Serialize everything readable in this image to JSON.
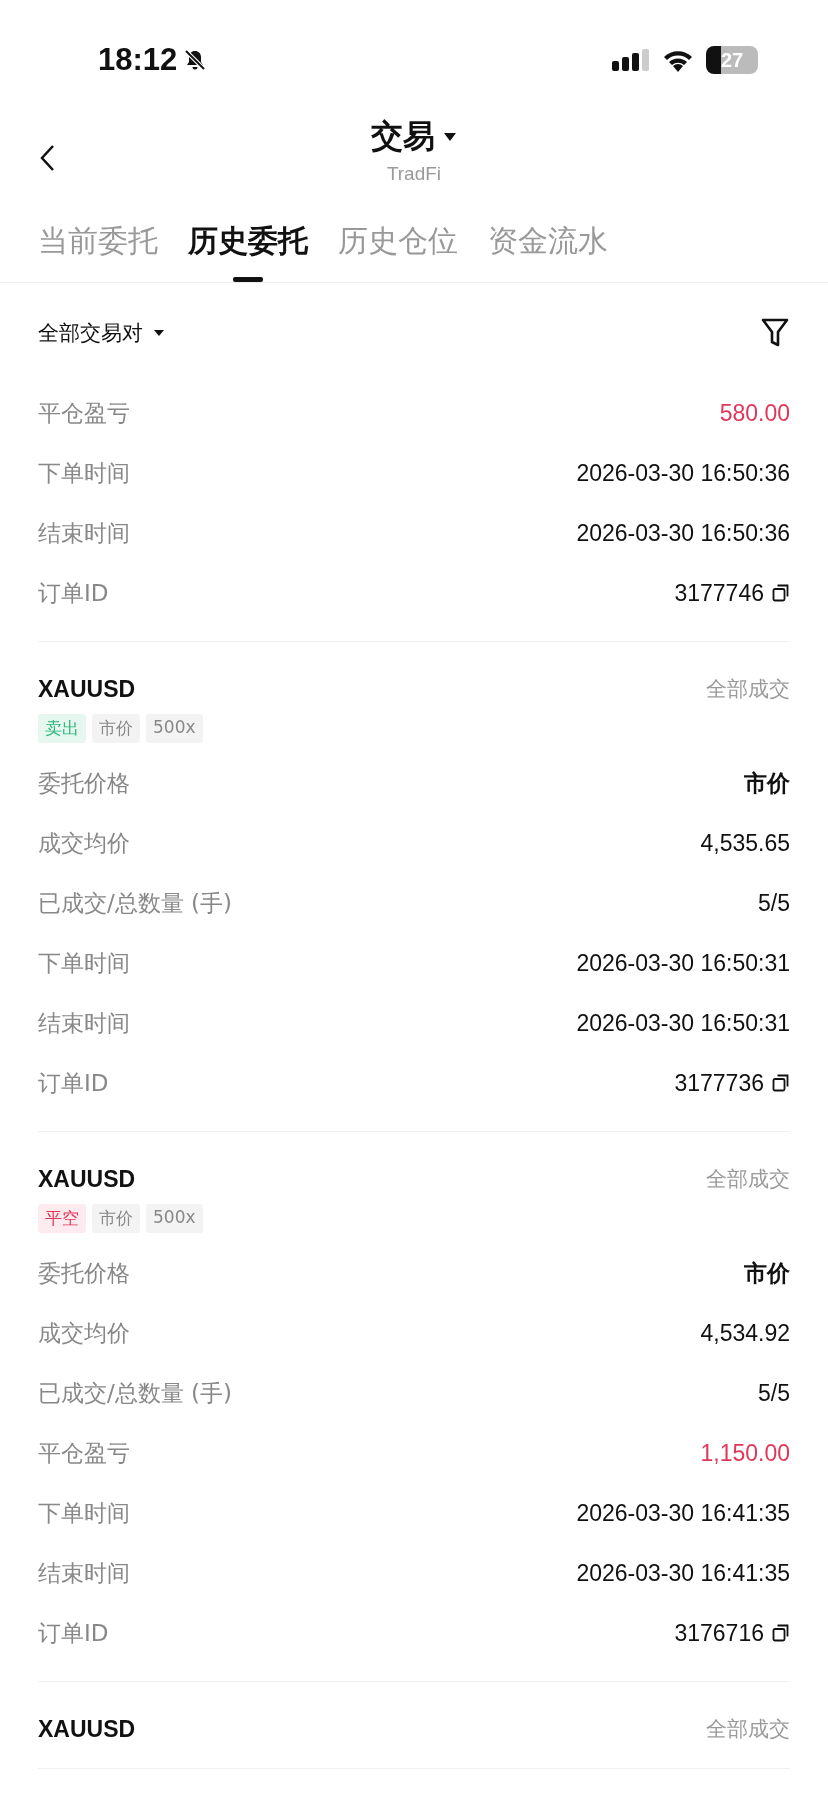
{
  "status_bar": {
    "time": "18:12",
    "battery": "27"
  },
  "header": {
    "title": "交易",
    "subtitle": "TradFi"
  },
  "tabs": [
    {
      "label": "当前委托",
      "selected": false
    },
    {
      "label": "历史委托",
      "selected": true
    },
    {
      "label": "历史仓位",
      "selected": false
    },
    {
      "label": "资金流水",
      "selected": false
    }
  ],
  "filter": {
    "label": "全部交易对"
  },
  "orders": [
    {
      "rows": [
        {
          "label": "平仓盈亏",
          "value": "580.00",
          "kind": "profit"
        },
        {
          "label": "下单时间",
          "value": "2026-03-30 16:50:36",
          "kind": "text"
        },
        {
          "label": "结束时间",
          "value": "2026-03-30 16:50:36",
          "kind": "text"
        },
        {
          "label": "订单ID",
          "value": "3177746",
          "kind": "id"
        }
      ]
    },
    {
      "symbol": "XAUUSD",
      "status": "全部成交",
      "tags": [
        {
          "label": "卖出",
          "kind": "sell"
        },
        {
          "label": "市价",
          "kind": "plain"
        },
        {
          "label": "500x",
          "kind": "plain"
        }
      ],
      "rows": [
        {
          "label": "委托价格",
          "value": "市价",
          "kind": "emphasis"
        },
        {
          "label": "成交均价",
          "value": "4,535.65",
          "kind": "text"
        },
        {
          "label": "已成交/总数量 (手)",
          "value": "5/5",
          "kind": "text"
        },
        {
          "label": "下单时间",
          "value": "2026-03-30 16:50:31",
          "kind": "text"
        },
        {
          "label": "结束时间",
          "value": "2026-03-30 16:50:31",
          "kind": "text"
        },
        {
          "label": "订单ID",
          "value": "3177736",
          "kind": "id"
        }
      ]
    },
    {
      "symbol": "XAUUSD",
      "status": "全部成交",
      "tags": [
        {
          "label": "平空",
          "kind": "close-short"
        },
        {
          "label": "市价",
          "kind": "plain"
        },
        {
          "label": "500x",
          "kind": "plain"
        }
      ],
      "rows": [
        {
          "label": "委托价格",
          "value": "市价",
          "kind": "emphasis"
        },
        {
          "label": "成交均价",
          "value": "4,534.92",
          "kind": "text"
        },
        {
          "label": "已成交/总数量 (手)",
          "value": "5/5",
          "kind": "text"
        },
        {
          "label": "平仓盈亏",
          "value": "1,150.00",
          "kind": "profit"
        },
        {
          "label": "下单时间",
          "value": "2026-03-30 16:41:35",
          "kind": "text"
        },
        {
          "label": "结束时间",
          "value": "2026-03-30 16:41:35",
          "kind": "text"
        },
        {
          "label": "订单ID",
          "value": "3176716",
          "kind": "id"
        }
      ]
    },
    {
      "symbol": "XAUUSD",
      "status": "全部成交"
    }
  ]
}
